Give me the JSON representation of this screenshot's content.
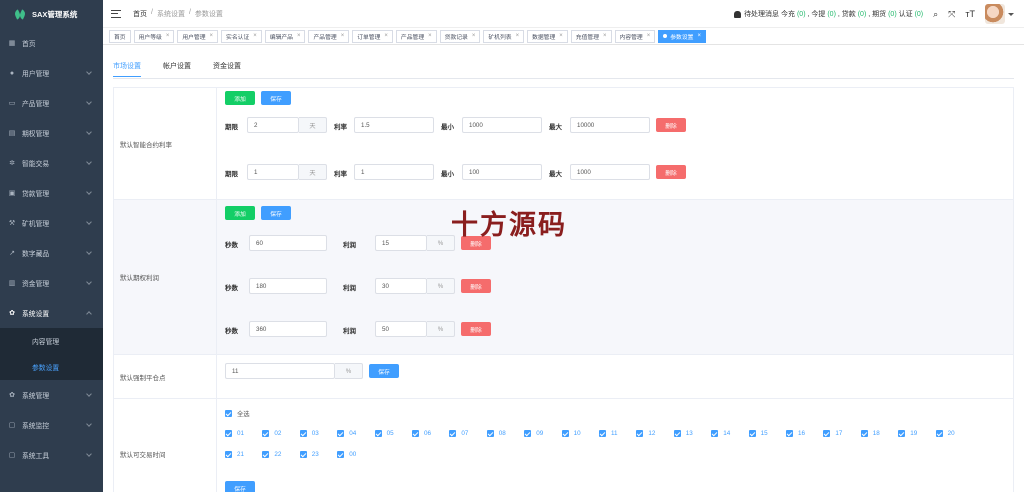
{
  "app": {
    "title": "SAX管理系统"
  },
  "sidebar": {
    "items": [
      {
        "label": "首页",
        "icon": "dashboard-icon"
      },
      {
        "label": "用户管理",
        "icon": "user-icon"
      },
      {
        "label": "产品管理",
        "icon": "product-icon"
      },
      {
        "label": "期权管理",
        "icon": "option-icon"
      },
      {
        "label": "智能交易",
        "icon": "gear-icon"
      },
      {
        "label": "贷款管理",
        "icon": "loan-icon"
      },
      {
        "label": "矿机管理",
        "icon": "miner-icon"
      },
      {
        "label": "数字藏品",
        "icon": "trend-icon"
      },
      {
        "label": "资金管理",
        "icon": "wallet-icon"
      },
      {
        "label": "系统设置",
        "icon": "settings-icon"
      },
      {
        "label": "系统管理",
        "icon": "gear-icon"
      },
      {
        "label": "系统监控",
        "icon": "monitor-icon"
      },
      {
        "label": "系统工具",
        "icon": "tool-icon"
      }
    ],
    "sub": [
      {
        "label": "内容管理"
      },
      {
        "label": "参数设置"
      }
    ]
  },
  "header": {
    "breadcrumb": [
      "首页",
      "/",
      "系统设置",
      "/",
      "参数设置"
    ],
    "pending_label": "待处理消息",
    "stats": [
      {
        "label": "今充",
        "value": "(0)"
      },
      {
        "label": "今提",
        "value": "(0)"
      },
      {
        "label": "贷款",
        "value": "(0)"
      },
      {
        "label": "期货",
        "value": "(0)"
      },
      {
        "label": "认证",
        "value": "(0)"
      }
    ],
    "separator": ",",
    "font_size_icon_text": "тT"
  },
  "tabs": [
    {
      "label": "首页",
      "closable": false
    },
    {
      "label": "用户等级",
      "closable": true
    },
    {
      "label": "用户管理",
      "closable": true
    },
    {
      "label": "实名认证",
      "closable": true
    },
    {
      "label": "编辑产品",
      "closable": true
    },
    {
      "label": "产品管理",
      "closable": true
    },
    {
      "label": "订单管理",
      "closable": true
    },
    {
      "label": "产品管理",
      "closable": true
    },
    {
      "label": "贷款记录",
      "closable": true
    },
    {
      "label": "矿机列表",
      "closable": true
    },
    {
      "label": "数据管理",
      "closable": true
    },
    {
      "label": "充值管理",
      "closable": true
    },
    {
      "label": "内容管理",
      "closable": true
    },
    {
      "label": "参数设置",
      "closable": true,
      "active": true
    }
  ],
  "tab_close_glyph": "×",
  "subtabs": [
    "市场设置",
    "帐户设置",
    "资金设置"
  ],
  "section1": {
    "label": "默认智能合约利率",
    "add_label": "添加",
    "save_label": "保存",
    "field_labels": {
      "term": "期限",
      "rate": "利率",
      "min": "最小",
      "max": "最大"
    },
    "unit_day": "天",
    "delete_label": "删除",
    "rows": [
      {
        "term": "2",
        "rate": "1.5",
        "min": "1000",
        "max": "10000"
      },
      {
        "term": "1",
        "rate": "1",
        "min": "100",
        "max": "1000"
      }
    ]
  },
  "section2": {
    "label": "默认期权利润",
    "add_label": "添加",
    "save_label": "保存",
    "field_labels": {
      "seconds": "秒数",
      "profit": "利润"
    },
    "unit_percent": "%",
    "delete_label": "删除",
    "rows": [
      {
        "seconds": "60",
        "profit": "15"
      },
      {
        "seconds": "180",
        "profit": "30"
      },
      {
        "seconds": "360",
        "profit": "50"
      }
    ]
  },
  "section3": {
    "label": "默认强制平仓点",
    "value": "11",
    "unit_percent": "%",
    "save_label": "保存"
  },
  "section4": {
    "label": "默认可交易时间",
    "select_all": "全选",
    "hours": [
      "01",
      "02",
      "03",
      "04",
      "05",
      "06",
      "07",
      "08",
      "09",
      "10",
      "11",
      "12",
      "13",
      "14",
      "15",
      "16",
      "17",
      "18",
      "19",
      "20",
      "21",
      "22",
      "23",
      "00"
    ],
    "save_label": "保存"
  },
  "watermark": "十方源码",
  "colors": {
    "sidebar_bg": "#2f3d4e",
    "primary": "#409eff",
    "success": "#13ce66",
    "danger": "#f56c6c"
  }
}
